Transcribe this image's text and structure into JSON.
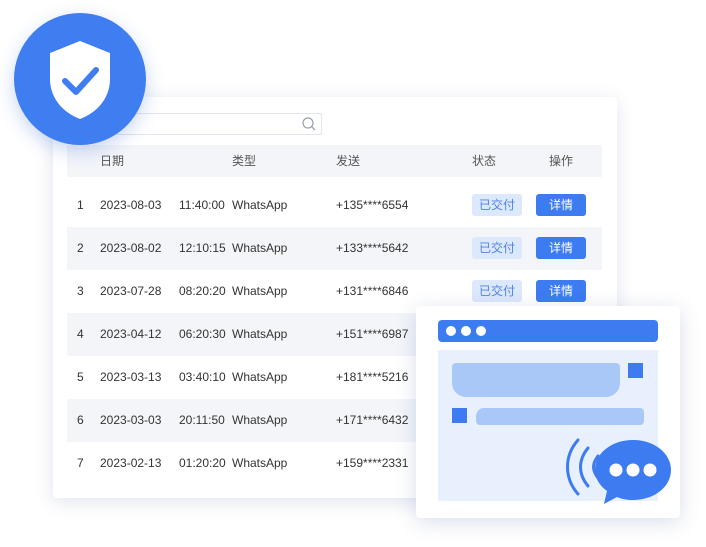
{
  "search": {
    "placeholder": ""
  },
  "table": {
    "headers": {
      "index": "",
      "date": "日期",
      "type": "类型",
      "send": "发送",
      "status": "状态",
      "action": "操作"
    },
    "rows": [
      {
        "index": "1",
        "date": "2023-08-03",
        "time": "11:40:00",
        "type": "WhatsApp",
        "send": "+135****6554",
        "status": "已交付",
        "action": "详情"
      },
      {
        "index": "2",
        "date": "2023-08-02",
        "time": "12:10:15",
        "type": "WhatsApp",
        "send": "+133****5642",
        "status": "已交付",
        "action": "详情"
      },
      {
        "index": "3",
        "date": "2023-07-28",
        "time": "08:20:20",
        "type": "WhatsApp",
        "send": "+131****6846",
        "status": "已交付",
        "action": "详情"
      },
      {
        "index": "4",
        "date": "2023-04-12",
        "time": "06:20:30",
        "type": "WhatsApp",
        "send": "+151****6987",
        "status": "",
        "action": ""
      },
      {
        "index": "5",
        "date": "2023-03-13",
        "time": "03:40:10",
        "type": "WhatsApp",
        "send": "+181****5216",
        "status": "",
        "action": ""
      },
      {
        "index": "6",
        "date": "2023-03-03",
        "time": "20:11:50",
        "type": "WhatsApp",
        "send": "+171****6432",
        "status": "",
        "action": ""
      },
      {
        "index": "7",
        "date": "2023-02-13",
        "time": "01:20:20",
        "type": "WhatsApp",
        "send": "+159****2331",
        "status": "",
        "action": ""
      }
    ]
  },
  "colors": {
    "accent": "#3d7cf0",
    "badge_bg": "#dce8fb",
    "badge_text": "#4e83e8",
    "header_bg": "#f3f5f9"
  },
  "icons": {
    "search": "search-icon",
    "shield": "shield-check-icon",
    "chat": "chat-bubble-icon",
    "signal": "signal-waves-icon"
  }
}
